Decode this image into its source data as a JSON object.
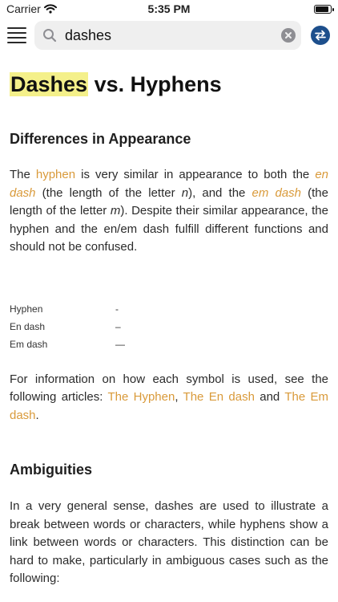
{
  "status_bar": {
    "carrier": "Carrier",
    "time": "5:35 PM"
  },
  "search": {
    "value": "dashes"
  },
  "article": {
    "title_highlight": "Dashes",
    "title_rest": " vs. Hyphens",
    "section1": {
      "heading": "Differences in Appearance",
      "p1": [
        "The ",
        "hyphen",
        " is very similar in appearance to both the ",
        "en dash",
        " (the length of the letter ",
        "n",
        "), and the ",
        "em dash",
        " (the length of the letter ",
        "m",
        "). Despite their similar appearance, the hyphen and the en/em dash fulfill different functions and should not be confused."
      ],
      "symbols": [
        {
          "name": "Hyphen",
          "glyph": "-"
        },
        {
          "name": "En dash",
          "glyph": "–"
        },
        {
          "name": "Em dash",
          "glyph": "—"
        }
      ],
      "p2": [
        "For information on how each symbol is used, see the following articles: ",
        "The Hyphen",
        ", ",
        "The En dash",
        " and ",
        "The Em dash",
        "."
      ]
    },
    "section2": {
      "heading": "Ambiguities",
      "p1": "In a very general sense, dashes are used to illustrate a break between words or characters, while hyphens show a link between words or characters. This distinction can be hard to make, particularly in ambiguous cases such as the following:"
    }
  },
  "colors": {
    "link": "#d99a3a",
    "highlight": "#f4f08a",
    "nav_button": "#1d4f8c"
  },
  "icons": [
    "wifi-icon",
    "battery-icon",
    "menu-icon",
    "search-icon",
    "clear-icon",
    "swap-arrows-icon"
  ]
}
